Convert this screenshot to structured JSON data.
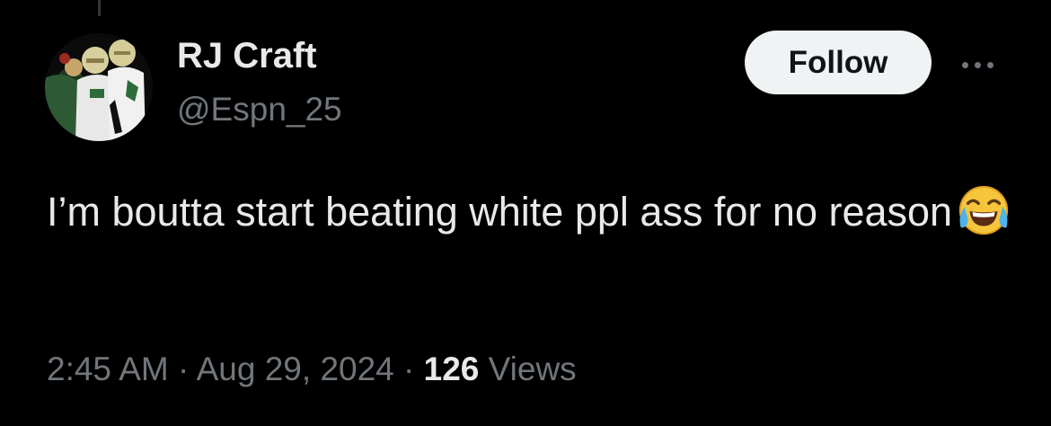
{
  "author": {
    "display_name": "RJ Craft",
    "handle": "@Espn_25",
    "avatar_icon": "football-players-photo"
  },
  "actions": {
    "follow_label": "Follow",
    "more_icon": "more-horizontal-icon"
  },
  "tweet": {
    "text": "I’m boutta start beating white ppl ass for no reason",
    "emoji": "face-with-tears-of-joy"
  },
  "meta": {
    "time": "2:45 AM",
    "separator": " · ",
    "date": "Aug 29, 2024",
    "views_count": "126",
    "views_label": "Views"
  },
  "colors": {
    "background": "#000000",
    "primary_text": "#e7e9ea",
    "secondary_text": "#71767b",
    "follow_button_bg": "#eff3f4",
    "follow_button_text": "#0f1419"
  }
}
